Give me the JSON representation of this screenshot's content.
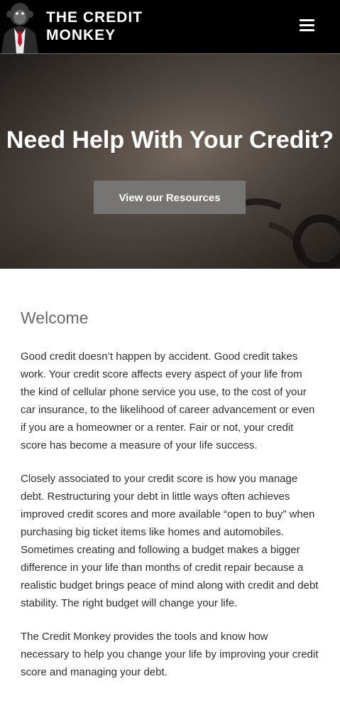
{
  "header": {
    "title_line1": "THE CREDIT",
    "title_line2": "MONKEY",
    "logo_icon": "monkey-in-suit-logo",
    "menu_icon": "hamburger-menu-icon"
  },
  "hero": {
    "title": "Need Help With Your Credit?",
    "button_label": "View our Resources"
  },
  "main": {
    "heading": "Welcome",
    "paragraphs": [
      "Good credit doesn’t happen by accident. Good credit takes work. Your credit score affects every aspect of your life from the kind of cellular phone service you use, to the cost of your car insurance, to the likelihood of career advancement or even if you are a homeowner or a renter. Fair or not, your credit score has become a measure of your life success.",
      "Closely associated to your credit score is how you manage debt. Restructuring your debt in little ways often achieves improved credit scores and more available “open to buy” when purchasing big ticket items like homes and automobiles. Sometimes creating and following a budget makes a bigger difference in your life than months of credit repair because a realistic budget brings peace of mind along with credit and debt stability. The right budget will change your life.",
      "The Credit Monkey provides the tools and know how necessary to help you change your life by improving your credit score and managing your debt."
    ]
  },
  "colors": {
    "header_bg": "#000000",
    "button_bg": "#777474",
    "heading_text": "#6a6a6a",
    "body_text": "#2e2e2e",
    "tie_red": "#c8102e"
  }
}
